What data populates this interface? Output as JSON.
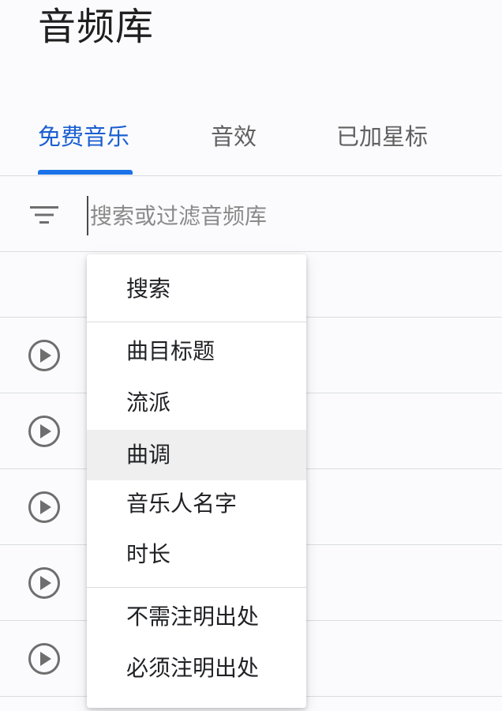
{
  "page": {
    "title": "音频库"
  },
  "tabs": [
    {
      "label": "免费音乐",
      "active": true
    },
    {
      "label": "音效",
      "active": false
    },
    {
      "label": "已加星标",
      "active": false
    }
  ],
  "search": {
    "placeholder": "搜索或过滤音频库",
    "value": ""
  },
  "dropdown": {
    "groups": [
      [
        "搜索"
      ],
      [
        "曲目标题",
        "流派",
        "曲调",
        "音乐人名字",
        "时长"
      ],
      [
        "不需注明出处",
        "必须注明出处"
      ]
    ],
    "highlighted": "曲调"
  },
  "track_rows": 5,
  "colors": {
    "accent": "#1a73e8",
    "active_tab_text": "#1a5fd0",
    "divider": "#dadce0",
    "icon": "#6e6e6e",
    "hover": "#efefef"
  },
  "icons": {
    "filter": "filter-lines-icon",
    "play": "play-circle-icon"
  }
}
